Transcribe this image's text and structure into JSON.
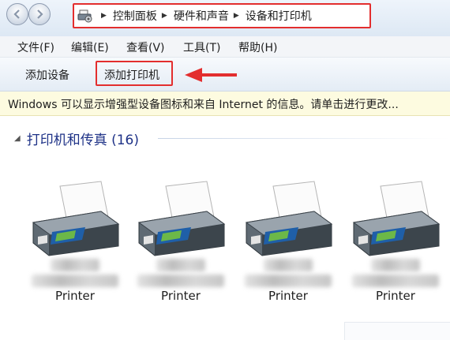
{
  "address": {
    "crumbs": [
      "控制面板",
      "硬件和声音",
      "设备和打印机"
    ],
    "icon": "devices-printers-icon"
  },
  "menu": {
    "items": [
      "文件(F)",
      "编辑(E)",
      "查看(V)",
      "工具(T)",
      "帮助(H)"
    ]
  },
  "toolbar": {
    "add_device": "添加设备",
    "add_printer": "添加打印机"
  },
  "infobar": {
    "text": "Windows 可以显示增强型设备图标和来自 Internet 的信息。请单击进行更改..."
  },
  "group": {
    "title": "打印机和传真 (16)"
  },
  "printers": [
    {
      "label": "Printer"
    },
    {
      "label": "Printer"
    },
    {
      "label": "Printer"
    },
    {
      "label": "Printer"
    }
  ],
  "colors": {
    "highlight": "#e32e2e",
    "group_header": "#1e3287",
    "infobar_bg": "#fdfbe0"
  }
}
